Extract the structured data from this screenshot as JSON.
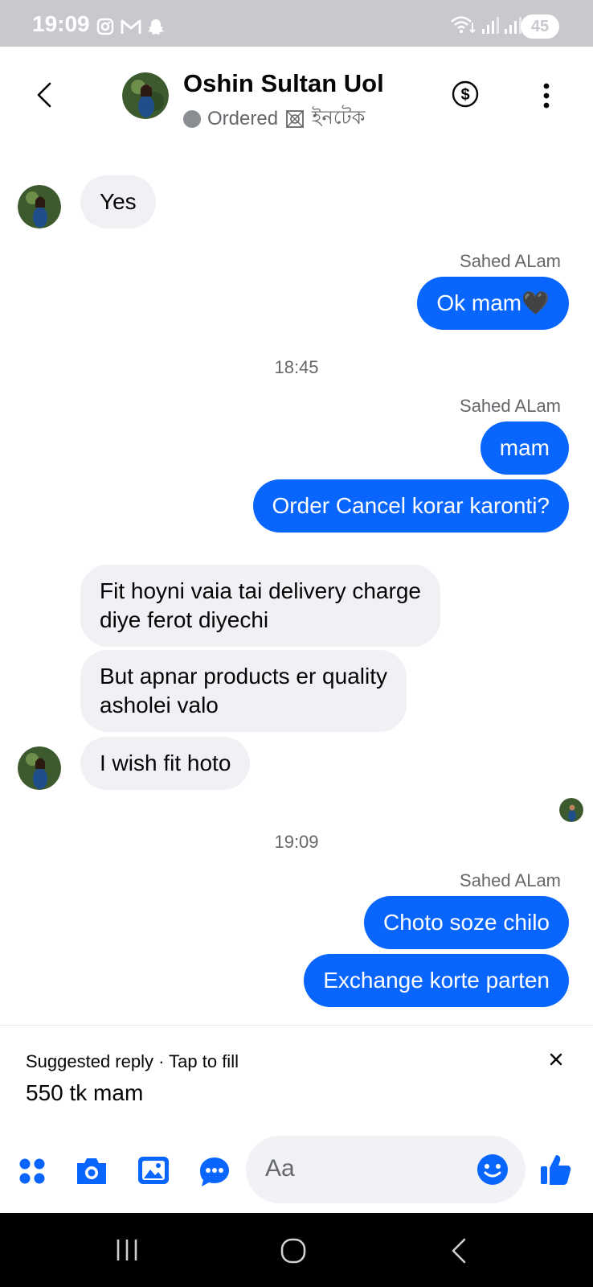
{
  "status_bar": {
    "time": "19:09",
    "battery": "45",
    "icons": [
      "instagram-icon",
      "gmail-icon",
      "snapchat-icon",
      "wifi-icon",
      "signal-icon",
      "signal-icon"
    ]
  },
  "header": {
    "name": "Oshin Sultan Uol",
    "label": "Ordered",
    "tag": "ইনটেক",
    "icons": [
      "back-icon",
      "dollar-icon",
      "more-icon"
    ]
  },
  "messages": [
    {
      "id": "m1",
      "dir": "in",
      "text": "Yes"
    },
    {
      "id": "s1",
      "sender": "Sahed ALam"
    },
    {
      "id": "m2",
      "dir": "out",
      "text": "Ok mam🖤"
    },
    {
      "id": "t1",
      "timestamp": "18:45"
    },
    {
      "id": "s2",
      "sender": "Sahed ALam"
    },
    {
      "id": "m3",
      "dir": "out",
      "text": "mam"
    },
    {
      "id": "m4",
      "dir": "out",
      "text": "Order Cancel korar karonti?"
    },
    {
      "id": "m5",
      "dir": "in",
      "lines": [
        "Fit hoyni vaia tai delivery charge",
        "diye ferot diyechi"
      ]
    },
    {
      "id": "m6",
      "dir": "in",
      "lines": [
        "But apnar products er quality",
        "asholei valo"
      ]
    },
    {
      "id": "m7",
      "dir": "in",
      "text": "I wish fit hoto"
    },
    {
      "id": "t2",
      "timestamp": "19:09"
    },
    {
      "id": "s3",
      "sender": "Sahed ALam"
    },
    {
      "id": "m8",
      "dir": "out",
      "text": "Choto soze chilo"
    },
    {
      "id": "m9",
      "dir": "out",
      "text": "Exchange korte parten"
    }
  ],
  "suggestion": {
    "heading": "Suggested reply",
    "sep": " · ",
    "hint": "Tap to fill",
    "text": "550 tk mam"
  },
  "composer": {
    "placeholder": "Aa",
    "icons": [
      "apps-icon",
      "camera-icon",
      "gallery-icon",
      "chat-bubble-icon",
      "emoji-icon",
      "thumbs-up-icon"
    ]
  },
  "colors": {
    "accent": "#0866ff",
    "incoming_bubble": "#f0f1f4",
    "status_bar": "#c8c9ce"
  }
}
